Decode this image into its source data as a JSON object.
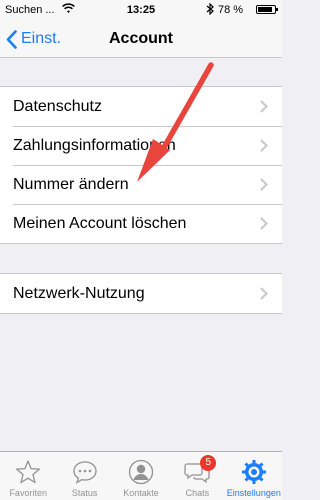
{
  "status_bar": {
    "carrier": "Suchen ...",
    "time": "13:25",
    "battery_text": "78 %",
    "battery_level": 0.78
  },
  "nav": {
    "back_label": "Einst.",
    "title": "Account"
  },
  "settings_group_1": [
    {
      "label": "Datenschutz"
    },
    {
      "label": "Zahlungsinformationen"
    },
    {
      "label": "Nummer ändern"
    },
    {
      "label": "Meinen Account löschen"
    }
  ],
  "settings_group_2": [
    {
      "label": "Netzwerk-Nutzung"
    }
  ],
  "tab_bar": {
    "tabs": [
      {
        "label": "Favoriten",
        "icon": "star-icon"
      },
      {
        "label": "Status",
        "icon": "status-bubble-icon"
      },
      {
        "label": "Kontakte",
        "icon": "contact-person-icon"
      },
      {
        "label": "Chats",
        "icon": "chat-bubbles-icon",
        "badge": "5"
      },
      {
        "label": "Einstellungen",
        "icon": "settings-gear-icon",
        "active": true
      }
    ]
  },
  "colors": {
    "accent": "#1a7dfb",
    "annotation_arrow": "#e8463c",
    "badge": "#e8372d"
  }
}
